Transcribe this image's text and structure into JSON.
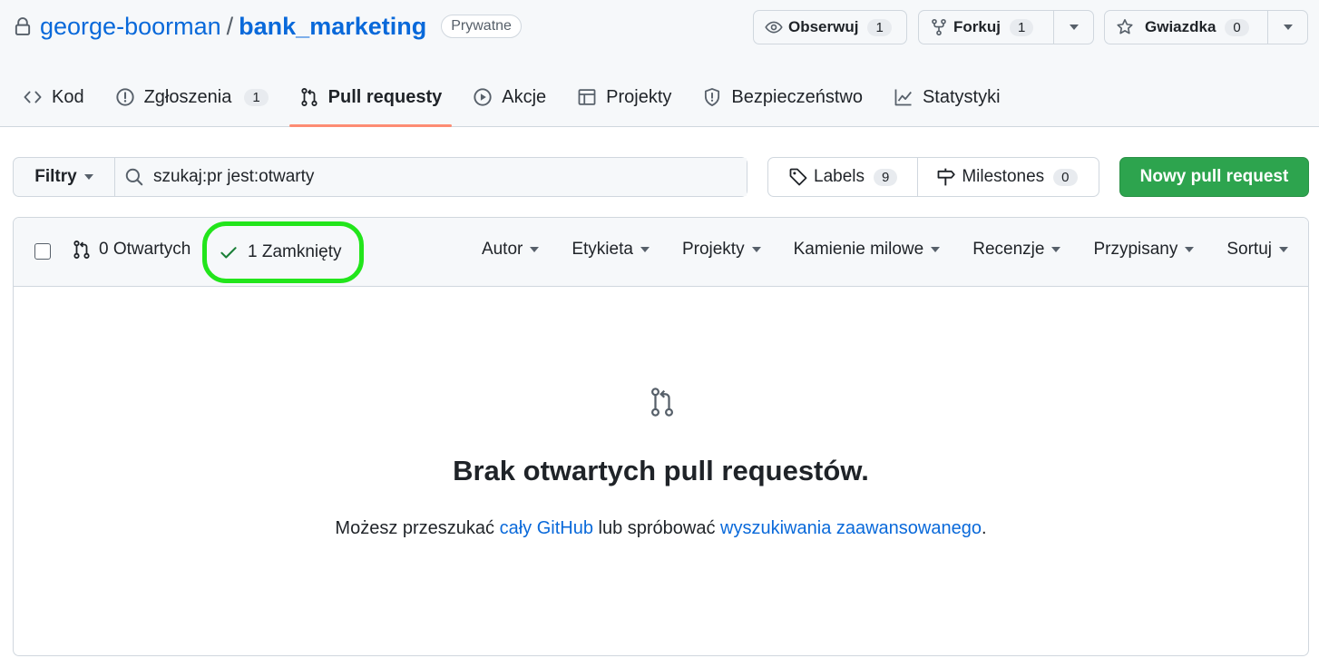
{
  "repo": {
    "owner": "george-boorman",
    "separator": "/",
    "name": "bank_marketing",
    "visibility": "Prywatne"
  },
  "actions": {
    "watch": {
      "label": "Obserwuj",
      "count": "1"
    },
    "fork": {
      "label": "Forkuj",
      "count": "1"
    },
    "star": {
      "label": "Gwiazdka",
      "count": "0"
    }
  },
  "tabs": [
    {
      "label": "Kod",
      "icon": "code-icon"
    },
    {
      "label": "Zgłoszenia",
      "count": "1",
      "icon": "issue-icon"
    },
    {
      "label": "Pull requesty",
      "icon": "pull-request-icon",
      "active": true
    },
    {
      "label": "Akcje",
      "icon": "play-icon"
    },
    {
      "label": "Projekty",
      "icon": "table-icon"
    },
    {
      "label": "Bezpieczeństwo",
      "icon": "shield-icon"
    },
    {
      "label": "Statystyki",
      "icon": "graph-icon"
    }
  ],
  "filters": {
    "button": "Filtry",
    "search_value": "szukaj:pr jest:otwarty"
  },
  "labels": {
    "label": "Labels",
    "count": "9"
  },
  "milestones": {
    "label": "Milestones",
    "count": "0"
  },
  "new_pr": "Nowy pull request",
  "list_header": {
    "open": "0 Otwartych",
    "closed": "1 Zamknięty",
    "filters": [
      "Autor",
      "Etykieta",
      "Projekty",
      "Kamienie milowe",
      "Recenzje",
      "Przypisany",
      "Sortuj"
    ]
  },
  "empty": {
    "title": "Brak otwartych pull requestów.",
    "text_before": "Możesz przeszukać ",
    "link1": "cały GitHub",
    "text_middle": " lub spróbować ",
    "link2": "wyszukiwania zaawansowanego",
    "text_after": "."
  },
  "colors": {
    "link": "#0969da",
    "primary_button": "#2da44e",
    "active_tab_underline": "#fd8c73",
    "highlight": "#22e51b"
  }
}
